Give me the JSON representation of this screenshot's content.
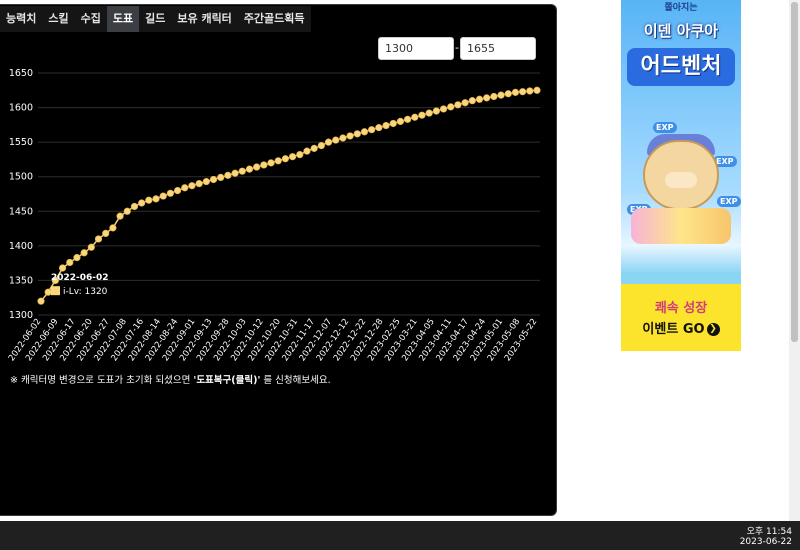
{
  "tabs": [
    {
      "label": "능력치",
      "active": false
    },
    {
      "label": "스킬",
      "active": false
    },
    {
      "label": "수집",
      "active": false
    },
    {
      "label": "도표",
      "active": true
    },
    {
      "label": "길드",
      "active": false
    },
    {
      "label": "보유 캐릭터",
      "active": false
    },
    {
      "label": "주간골드획득",
      "active": false
    }
  ],
  "range": {
    "min": "1300",
    "max": "1655",
    "separator": "-"
  },
  "chart_data": {
    "type": "line",
    "series": [
      {
        "name": "i-Lv",
        "color": "#f9d67a"
      }
    ],
    "ylim": [
      1300,
      1650
    ],
    "yticks": [
      1300,
      1350,
      1400,
      1450,
      1500,
      1550,
      1600,
      1650
    ],
    "xtick_labels": [
      "2022-06-02",
      "2022-06-09",
      "2022-06-17",
      "2022-06-20",
      "2022-06-27",
      "2022-07-08",
      "2022-07-16",
      "2022-08-14",
      "2022-08-24",
      "2022-09-01",
      "2022-09-13",
      "2022-09-28",
      "2022-10-03",
      "2022-10-12",
      "2022-10-20",
      "2022-10-31",
      "2022-11-17",
      "2022-12-07",
      "2022-12-12",
      "2022-12-22",
      "2022-12-28",
      "2023-02-25",
      "2023-03-21",
      "2023-04-05",
      "2023-04-11",
      "2023-04-17",
      "2023-04-24",
      "2023-05-01",
      "2023-05-08",
      "2023-05-22"
    ],
    "values": [
      1320,
      1333,
      1350,
      1368,
      1376,
      1383,
      1390,
      1398,
      1410,
      1418,
      1426,
      1443,
      1450,
      1457,
      1462,
      1466,
      1468,
      1472,
      1476,
      1480,
      1484,
      1487,
      1490,
      1493,
      1496,
      1499,
      1502,
      1505,
      1508,
      1511,
      1514,
      1517,
      1520,
      1523,
      1526,
      1529,
      1532,
      1537,
      1541,
      1545,
      1550,
      1553,
      1556,
      1559,
      1562,
      1565,
      1568,
      1571,
      1574,
      1577,
      1580,
      1583,
      1586,
      1589,
      1592,
      1595,
      1598,
      1601,
      1604,
      1607,
      1610,
      1612,
      1614,
      1616,
      1618,
      1620,
      1622,
      1623,
      1624,
      1625
    ],
    "tooltip": {
      "date": "2022-06-02",
      "label": "i-Lv: 1320"
    }
  },
  "notice": {
    "prefix": "※ 캐릭터명 변경으로 도표가 초기화 되셨으면 ",
    "highlight": "'도표복구(클릭)'",
    "suffix": " 를 신청해보세요."
  },
  "ad": {
    "top_text": "쫄아지는",
    "title1": "이덴 아쿠아",
    "title2": "어드벤처",
    "exp_label": "EXP",
    "bottom1": "쾌속 성장",
    "bottom2": "이벤트 GO",
    "go_icon": "❯"
  },
  "clock": {
    "time": "오후 11:54",
    "date": "2023-06-22"
  }
}
